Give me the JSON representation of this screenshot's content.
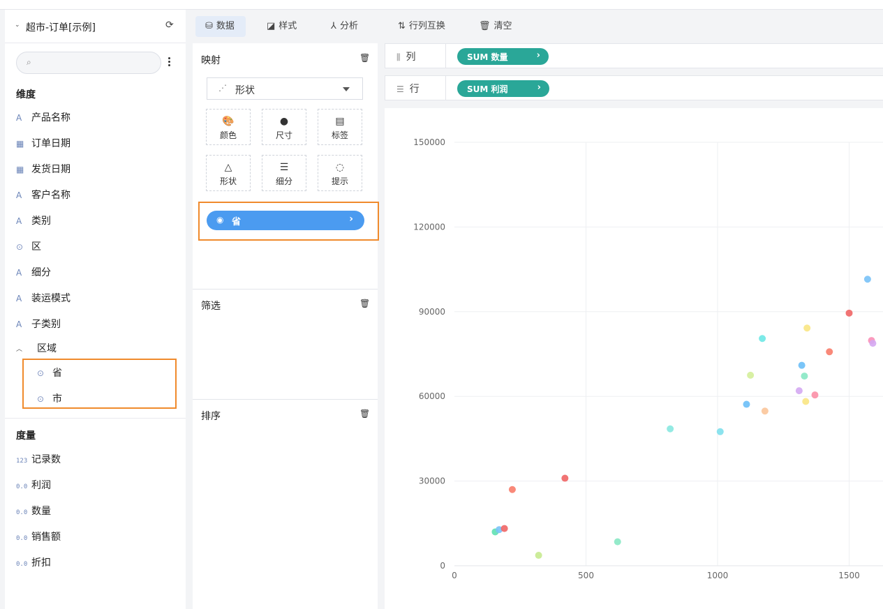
{
  "datasource": {
    "title": "超市-订单[示例]"
  },
  "search": {
    "placeholder": ""
  },
  "dimensions": {
    "title": "维度",
    "items": [
      {
        "label": "产品名称",
        "icon": "A"
      },
      {
        "label": "订单日期",
        "icon": "calendar"
      },
      {
        "label": "发货日期",
        "icon": "calendar"
      },
      {
        "label": "客户名称",
        "icon": "A"
      },
      {
        "label": "类别",
        "icon": "A"
      },
      {
        "label": "区",
        "icon": "pin"
      },
      {
        "label": "细分",
        "icon": "A"
      },
      {
        "label": "装运模式",
        "icon": "A"
      },
      {
        "label": "子类别",
        "icon": "A"
      }
    ],
    "group": {
      "label": "区域",
      "items": [
        {
          "label": "省"
        },
        {
          "label": "市"
        }
      ]
    }
  },
  "measures": {
    "title": "度量",
    "items": [
      {
        "label": "记录数",
        "icon": "123"
      },
      {
        "label": "利润",
        "icon": "0.0"
      },
      {
        "label": "数量",
        "icon": "0.0"
      },
      {
        "label": "销售额",
        "icon": "0.0"
      },
      {
        "label": "折扣",
        "icon": "0.0"
      }
    ]
  },
  "toolbar": {
    "data": "数据",
    "style": "样式",
    "analysis": "分析",
    "swap": "行列互换",
    "clear": "清空"
  },
  "mapping": {
    "title": "映射",
    "chart_type": "形状",
    "buttons": {
      "color": "颜色",
      "size": "尺寸",
      "label": "标签",
      "shape": "形状",
      "detail": "细分",
      "tooltip": "提示"
    },
    "field_pill": "省"
  },
  "filter": {
    "title": "筛选"
  },
  "sort": {
    "title": "排序"
  },
  "shelves": {
    "columns": {
      "label": "列",
      "chip": "SUM 数量"
    },
    "rows": {
      "label": "行",
      "chip": "SUM 利润"
    }
  },
  "chart_data": {
    "type": "scatter",
    "xlim": [
      0,
      1600
    ],
    "ylim": [
      0,
      150000
    ],
    "x_ticks": [
      0,
      500,
      1000,
      1500
    ],
    "y_ticks": [
      0,
      30000,
      60000,
      90000,
      120000,
      150000
    ],
    "grid": true,
    "points": [
      {
        "x": 155,
        "y": 12000,
        "color": "#5fe0b3"
      },
      {
        "x": 170,
        "y": 12800,
        "color": "#79c2f7"
      },
      {
        "x": 190,
        "y": 13200,
        "color": "#f06565"
      },
      {
        "x": 220,
        "y": 27000,
        "color": "#f87c6a"
      },
      {
        "x": 320,
        "y": 3700,
        "color": "#c7ea8f"
      },
      {
        "x": 420,
        "y": 31000,
        "color": "#f06565"
      },
      {
        "x": 620,
        "y": 8500,
        "color": "#88e8c4"
      },
      {
        "x": 820,
        "y": 48500,
        "color": "#88e8e0"
      },
      {
        "x": 1010,
        "y": 47500,
        "color": "#7fe0ec"
      },
      {
        "x": 1110,
        "y": 57200,
        "color": "#6bbff7"
      },
      {
        "x": 1125,
        "y": 67500,
        "color": "#d4ee9a"
      },
      {
        "x": 1170,
        "y": 80500,
        "color": "#6ee8e6"
      },
      {
        "x": 1180,
        "y": 54800,
        "color": "#fbc59a"
      },
      {
        "x": 1310,
        "y": 62000,
        "color": "#d4a8f2"
      },
      {
        "x": 1320,
        "y": 71000,
        "color": "#6bbff7"
      },
      {
        "x": 1330,
        "y": 67200,
        "color": "#88e8c4"
      },
      {
        "x": 1335,
        "y": 58200,
        "color": "#fae683"
      },
      {
        "x": 1340,
        "y": 84200,
        "color": "#fae683"
      },
      {
        "x": 1370,
        "y": 60500,
        "color": "#fb8fa6"
      },
      {
        "x": 1425,
        "y": 75800,
        "color": "#f87c6a"
      },
      {
        "x": 1500,
        "y": 89500,
        "color": "#f06565"
      },
      {
        "x": 1570,
        "y": 101500,
        "color": "#79c2f7"
      },
      {
        "x": 1585,
        "y": 79800,
        "color": "#fb8fb6"
      },
      {
        "x": 1590,
        "y": 78800,
        "color": "#d4a8f2"
      }
    ]
  }
}
